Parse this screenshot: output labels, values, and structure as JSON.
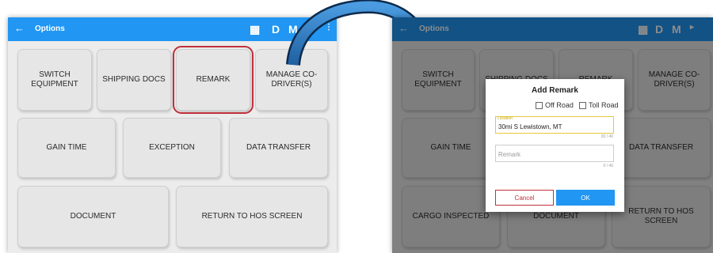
{
  "left": {
    "appbar": {
      "back_icon": "arrow-left-icon",
      "title": "Options",
      "icons": [
        "chat-icon",
        "D",
        "M",
        "more-icon"
      ]
    },
    "tiles": [
      "SWITCH EQUIPMENT",
      "SHIPPING DOCS",
      "REMARK",
      "MANAGE CO-DRIVER(S)",
      "GAIN TIME",
      "EXCEPTION",
      "DATA TRANSFER",
      "DOCUMENT",
      "RETURN TO HOS SCREEN"
    ]
  },
  "right": {
    "appbar": {
      "title": "Options"
    },
    "tiles": [
      "SWITCH EQUIPMENT",
      "SHIPPING DOCS",
      "REMARK",
      "MANAGE CO-DRIVER(S)",
      "GAIN TIME",
      "DATA TRANSFER",
      "CARGO INSPECTED",
      "DOCUMENT",
      "RETURN TO HOS SCREEN"
    ],
    "dialog": {
      "title": "Add Remark",
      "off_road": "Off Road",
      "toll_road": "Toll Road",
      "location_label": "Location",
      "location_value": "30mi S Lewistown, MT",
      "location_counter": "20 / 40",
      "remark_placeholder": "Remark",
      "remark_counter": "0 / 40",
      "cancel": "Cancel",
      "ok": "OK"
    }
  },
  "colors": {
    "appbar": "#2196f3",
    "highlight": "#c0303b",
    "arrow": "#1f5fa0"
  }
}
